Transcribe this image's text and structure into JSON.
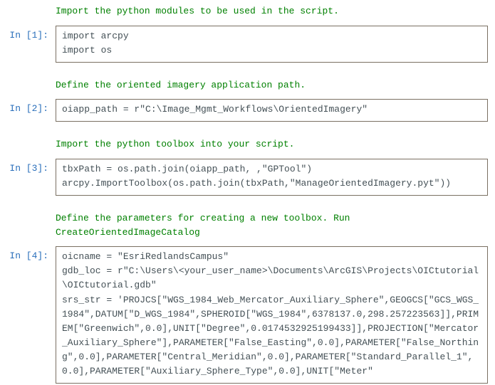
{
  "cells": {
    "md1": "Import the python modules to be used in the script.",
    "prompt1": "In [1]:",
    "code1": "import arcpy\nimport os",
    "md2": "Define the oriented imagery application path.",
    "prompt2": "In [2]:",
    "code2": "oiapp_path = r\"C:\\Image_Mgmt_Workflows\\OrientedImagery\"",
    "md3": "Import the python toolbox into your script.",
    "prompt3": "In [3]:",
    "code3": "tbxPath = os.path.join(oiapp_path, ,\"GPTool\")\narcpy.ImportToolbox(os.path.join(tbxPath,\"ManageOrientedImagery.pyt\"))",
    "md4a": "Define the parameters for creating a new toolbox. Run",
    "md4b": "CreateOrientedImageCatalog",
    "prompt4": "In [4]:",
    "code4": "oicname = \"EsriRedlandsCampus\"\ngdb_loc = r\"C:\\Users\\<your_user_name>\\Documents\\ArcGIS\\Projects\\OICtutorial\\OICtutorial.gdb\"\nsrs_str = 'PROJCS[\"WGS_1984_Web_Mercator_Auxiliary_Sphere\",GEOGCS[\"GCS_WGS_1984\",DATUM[\"D_WGS_1984\",SPHEROID[\"WGS_1984\",6378137.0,298.257223563]],PRIMEM[\"Greenwich\",0.0],UNIT[\"Degree\",0.0174532925199433]],PROJECTION[\"Mercator_Auxiliary_Sphere\"],PARAMETER[\"False_Easting\",0.0],PARAMETER[\"False_Northing\",0.0],PARAMETER[\"Central_Meridian\",0.0],PARAMETER[\"Standard_Parallel_1\",0.0],PARAMETER[\"Auxiliary_Sphere_Type\",0.0],UNIT[\"Meter\""
  }
}
